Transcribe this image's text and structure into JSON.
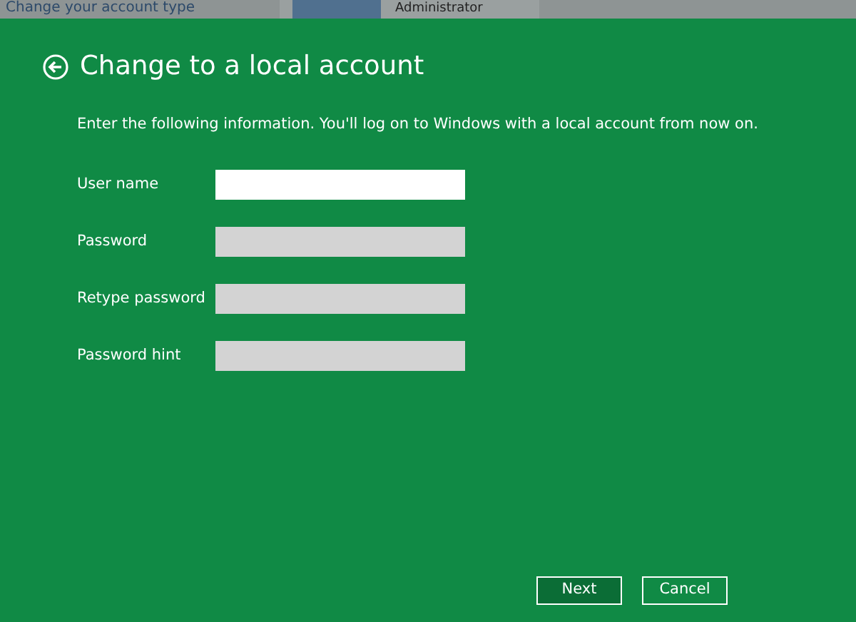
{
  "background_window": {
    "link": "Change your account type",
    "account_name": "Administrator"
  },
  "dialog": {
    "title": "Change to a local account",
    "instruction": "Enter the following information. You'll log on to Windows with a local account from now on.",
    "fields": [
      {
        "label": "User name",
        "focused": true
      },
      {
        "label": "Password",
        "focused": false
      },
      {
        "label": "Retype password",
        "focused": false
      },
      {
        "label": "Password hint",
        "focused": false
      }
    ],
    "buttons": [
      {
        "label": "Next",
        "default": true
      },
      {
        "label": "Cancel",
        "default": false
      }
    ]
  }
}
